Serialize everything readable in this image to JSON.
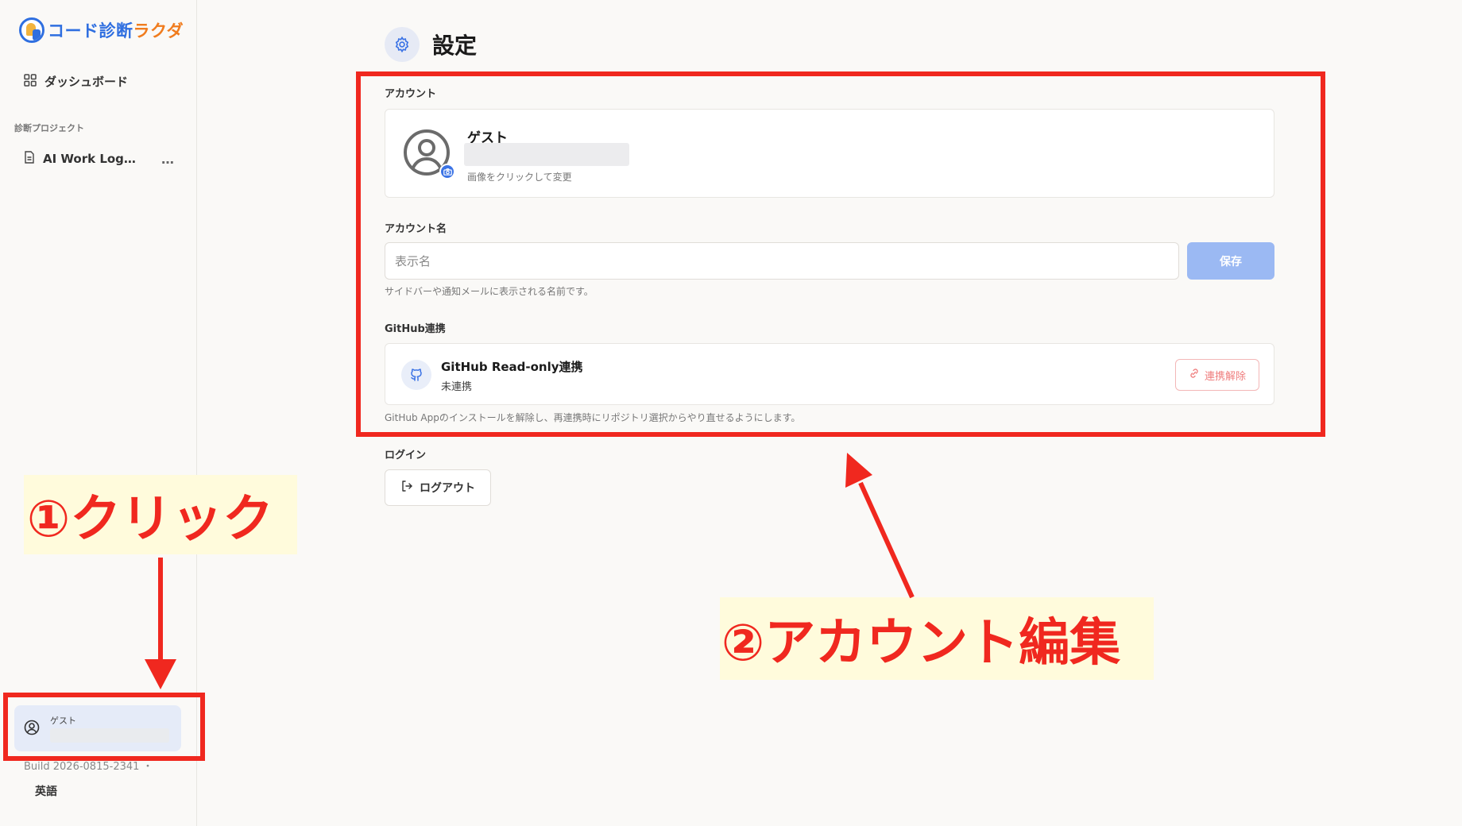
{
  "app": {
    "logo_part_a": "コード診断",
    "logo_part_b": "ラクダ",
    "brand_blue": "#2f6fe0",
    "brand_orange": "#f07c1e"
  },
  "sidebar": {
    "dashboard_label": "ダッシュボード",
    "section_label": "診断プロジェクト",
    "project_label": "AI Work Log…",
    "project_more": "…",
    "user_name": "ゲスト",
    "build_text": "Build 2026-0815-2341 ・",
    "language_label": "英語"
  },
  "page": {
    "title": "設定"
  },
  "account": {
    "section_label": "アカウント",
    "name": "ゲスト",
    "avatar_hint": "画像をクリックして変更"
  },
  "account_name": {
    "section_label": "アカウント名",
    "placeholder": "表示名",
    "save_label": "保存",
    "help": "サイドバーや通知メールに表示される名前です。"
  },
  "github": {
    "section_label": "GitHub連携",
    "title": "GitHub Read-only連携",
    "status": "未連携",
    "disconnect_label": "連携解除",
    "help": "GitHub Appのインストールを解除し、再連携時にリポジトリ選択からやり直せるようにします。"
  },
  "login": {
    "section_label": "ログイン",
    "logout_label": "ログアウト"
  },
  "annotations": {
    "step1": "①クリック",
    "step2": "②アカウント編集",
    "color": "#f0281f"
  }
}
